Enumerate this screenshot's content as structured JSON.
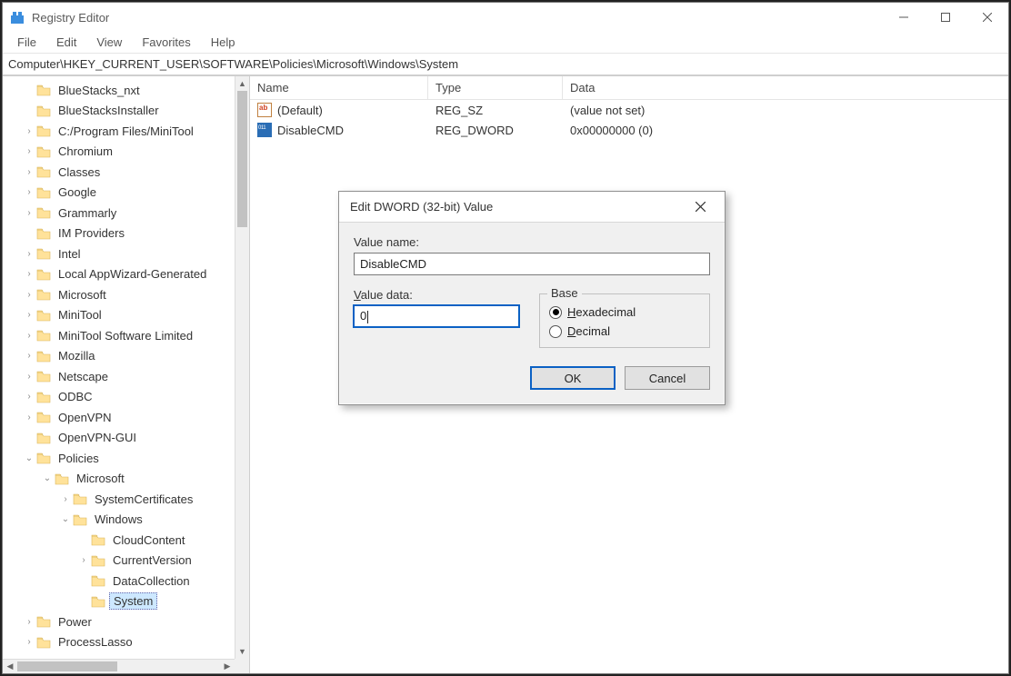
{
  "window": {
    "title": "Registry Editor"
  },
  "menu": {
    "file": "File",
    "edit": "Edit",
    "view": "View",
    "favorites": "Favorites",
    "help": "Help"
  },
  "address": "Computer\\HKEY_CURRENT_USER\\SOFTWARE\\Policies\\Microsoft\\Windows\\System",
  "columns": {
    "name": "Name",
    "type": "Type",
    "data": "Data"
  },
  "values": [
    {
      "name": "(Default)",
      "type": "REG_SZ",
      "data": "(value not set)",
      "iconClass": "val-icon-ab"
    },
    {
      "name": "DisableCMD",
      "type": "REG_DWORD",
      "data": "0x00000000 (0)",
      "iconClass": "val-icon-dw"
    }
  ],
  "tree": [
    {
      "indent": 1,
      "expander": " ",
      "label": "BlueStacks_nxt"
    },
    {
      "indent": 1,
      "expander": " ",
      "label": "BlueStacksInstaller"
    },
    {
      "indent": 1,
      "expander": ">",
      "label": "C:/Program Files/MiniTool"
    },
    {
      "indent": 1,
      "expander": ">",
      "label": "Chromium"
    },
    {
      "indent": 1,
      "expander": ">",
      "label": "Classes"
    },
    {
      "indent": 1,
      "expander": ">",
      "label": "Google"
    },
    {
      "indent": 1,
      "expander": ">",
      "label": "Grammarly"
    },
    {
      "indent": 1,
      "expander": " ",
      "label": "IM Providers"
    },
    {
      "indent": 1,
      "expander": ">",
      "label": "Intel"
    },
    {
      "indent": 1,
      "expander": ">",
      "label": "Local AppWizard-Generated"
    },
    {
      "indent": 1,
      "expander": ">",
      "label": "Microsoft"
    },
    {
      "indent": 1,
      "expander": ">",
      "label": "MiniTool"
    },
    {
      "indent": 1,
      "expander": ">",
      "label": "MiniTool Software Limited"
    },
    {
      "indent": 1,
      "expander": ">",
      "label": "Mozilla"
    },
    {
      "indent": 1,
      "expander": ">",
      "label": "Netscape"
    },
    {
      "indent": 1,
      "expander": ">",
      "label": "ODBC"
    },
    {
      "indent": 1,
      "expander": ">",
      "label": "OpenVPN"
    },
    {
      "indent": 1,
      "expander": " ",
      "label": "OpenVPN-GUI"
    },
    {
      "indent": 1,
      "expander": "v",
      "label": "Policies"
    },
    {
      "indent": 2,
      "expander": "v",
      "label": "Microsoft"
    },
    {
      "indent": 3,
      "expander": ">",
      "label": "SystemCertificates"
    },
    {
      "indent": 3,
      "expander": "v",
      "label": "Windows"
    },
    {
      "indent": 4,
      "expander": " ",
      "label": "CloudContent"
    },
    {
      "indent": 4,
      "expander": ">",
      "label": "CurrentVersion"
    },
    {
      "indent": 4,
      "expander": " ",
      "label": "DataCollection"
    },
    {
      "indent": 4,
      "expander": " ",
      "label": "System",
      "selected": true
    },
    {
      "indent": 1,
      "expander": ">",
      "label": "Power"
    },
    {
      "indent": 1,
      "expander": ">",
      "label": "ProcessLasso"
    }
  ],
  "dialog": {
    "title": "Edit DWORD (32-bit) Value",
    "valueNameLabel": "Value name:",
    "valueName": "DisableCMD",
    "valueDataLabel": "Value data:",
    "valueData": "0",
    "baseLabel": "Base",
    "hexLabel": "Hexadecimal",
    "decLabel": "Decimal",
    "ok": "OK",
    "cancel": "Cancel"
  }
}
